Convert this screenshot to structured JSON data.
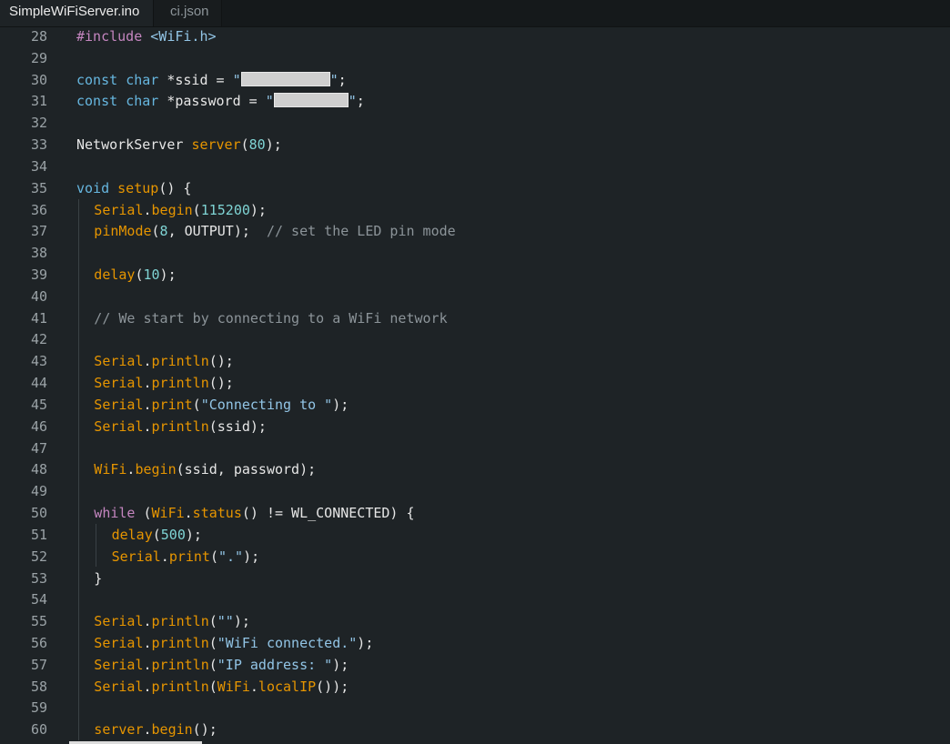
{
  "tabs": [
    {
      "label": "SimpleWiFiServer.ino",
      "active": true
    },
    {
      "label": "ci.json",
      "active": false
    }
  ],
  "colors": {
    "background": "#1e2326",
    "tabbar": "#15191b",
    "keyword": "#66b6df",
    "function": "#e69500",
    "number": "#7fd4d4",
    "string": "#92c5e6",
    "comment": "#8c9499",
    "preprocessor": "#c586c0"
  },
  "lines": [
    {
      "n": "28",
      "tokens": [
        {
          "t": "#include",
          "c": "inc"
        },
        {
          "t": " "
        },
        {
          "t": "<WiFi.h>",
          "c": "hdr"
        }
      ]
    },
    {
      "n": "29",
      "tokens": []
    },
    {
      "n": "30",
      "tokens": [
        {
          "t": "const",
          "c": "kw"
        },
        {
          "t": " "
        },
        {
          "t": "char",
          "c": "kw"
        },
        {
          "t": " *ssid = "
        },
        {
          "t": "\"",
          "c": "str"
        },
        {
          "redact": "long"
        },
        {
          "t": "\"",
          "c": "str"
        },
        {
          "t": ";"
        }
      ]
    },
    {
      "n": "31",
      "tokens": [
        {
          "t": "const",
          "c": "kw"
        },
        {
          "t": " "
        },
        {
          "t": "char",
          "c": "kw"
        },
        {
          "t": " *password = "
        },
        {
          "t": "\"",
          "c": "str"
        },
        {
          "redact": "short"
        },
        {
          "t": "\"",
          "c": "str"
        },
        {
          "t": ";"
        }
      ]
    },
    {
      "n": "32",
      "tokens": []
    },
    {
      "n": "33",
      "tokens": [
        {
          "t": "NetworkServer "
        },
        {
          "t": "server",
          "c": "fn"
        },
        {
          "t": "("
        },
        {
          "t": "80",
          "c": "num"
        },
        {
          "t": ");"
        }
      ]
    },
    {
      "n": "34",
      "tokens": []
    },
    {
      "n": "35",
      "tokens": [
        {
          "t": "void",
          "c": "kw"
        },
        {
          "t": " "
        },
        {
          "t": "setup",
          "c": "fn"
        },
        {
          "t": "() {"
        }
      ]
    },
    {
      "n": "36",
      "indent": 1,
      "tokens": [
        {
          "t": "Serial",
          "c": "fn"
        },
        {
          "t": "."
        },
        {
          "t": "begin",
          "c": "fn"
        },
        {
          "t": "("
        },
        {
          "t": "115200",
          "c": "num"
        },
        {
          "t": ");"
        }
      ]
    },
    {
      "n": "37",
      "indent": 1,
      "tokens": [
        {
          "t": "pinMode",
          "c": "fn"
        },
        {
          "t": "("
        },
        {
          "t": "8",
          "c": "num"
        },
        {
          "t": ", OUTPUT);  "
        },
        {
          "t": "// set the LED pin mode",
          "c": "com"
        }
      ]
    },
    {
      "n": "38",
      "tokens": []
    },
    {
      "n": "39",
      "indent": 1,
      "tokens": [
        {
          "t": "delay",
          "c": "fn"
        },
        {
          "t": "("
        },
        {
          "t": "10",
          "c": "num"
        },
        {
          "t": ");"
        }
      ]
    },
    {
      "n": "40",
      "tokens": []
    },
    {
      "n": "41",
      "indent": 1,
      "tokens": [
        {
          "t": "// We start by connecting to a WiFi network",
          "c": "com"
        }
      ]
    },
    {
      "n": "42",
      "tokens": []
    },
    {
      "n": "43",
      "indent": 1,
      "tokens": [
        {
          "t": "Serial",
          "c": "fn"
        },
        {
          "t": "."
        },
        {
          "t": "println",
          "c": "fn"
        },
        {
          "t": "();"
        }
      ]
    },
    {
      "n": "44",
      "indent": 1,
      "tokens": [
        {
          "t": "Serial",
          "c": "fn"
        },
        {
          "t": "."
        },
        {
          "t": "println",
          "c": "fn"
        },
        {
          "t": "();"
        }
      ]
    },
    {
      "n": "45",
      "indent": 1,
      "tokens": [
        {
          "t": "Serial",
          "c": "fn"
        },
        {
          "t": "."
        },
        {
          "t": "print",
          "c": "fn"
        },
        {
          "t": "("
        },
        {
          "t": "\"Connecting to \"",
          "c": "str"
        },
        {
          "t": ");"
        }
      ]
    },
    {
      "n": "46",
      "indent": 1,
      "tokens": [
        {
          "t": "Serial",
          "c": "fn"
        },
        {
          "t": "."
        },
        {
          "t": "println",
          "c": "fn"
        },
        {
          "t": "(ssid);"
        }
      ]
    },
    {
      "n": "47",
      "tokens": []
    },
    {
      "n": "48",
      "indent": 1,
      "tokens": [
        {
          "t": "WiFi",
          "c": "fn"
        },
        {
          "t": "."
        },
        {
          "t": "begin",
          "c": "fn"
        },
        {
          "t": "(ssid, password);"
        }
      ]
    },
    {
      "n": "49",
      "tokens": []
    },
    {
      "n": "50",
      "indent": 1,
      "tokens": [
        {
          "t": "while",
          "c": "kw2"
        },
        {
          "t": " ("
        },
        {
          "t": "WiFi",
          "c": "fn"
        },
        {
          "t": "."
        },
        {
          "t": "status",
          "c": "fn"
        },
        {
          "t": "() != WL_CONNECTED) {"
        }
      ]
    },
    {
      "n": "51",
      "indent": 2,
      "tokens": [
        {
          "t": "delay",
          "c": "fn"
        },
        {
          "t": "("
        },
        {
          "t": "500",
          "c": "num"
        },
        {
          "t": ");"
        }
      ]
    },
    {
      "n": "52",
      "indent": 2,
      "tokens": [
        {
          "t": "Serial",
          "c": "fn"
        },
        {
          "t": "."
        },
        {
          "t": "print",
          "c": "fn"
        },
        {
          "t": "("
        },
        {
          "t": "\".\"",
          "c": "str"
        },
        {
          "t": ");"
        }
      ]
    },
    {
      "n": "53",
      "indent": 1,
      "tokens": [
        {
          "t": "}"
        }
      ]
    },
    {
      "n": "54",
      "tokens": []
    },
    {
      "n": "55",
      "indent": 1,
      "tokens": [
        {
          "t": "Serial",
          "c": "fn"
        },
        {
          "t": "."
        },
        {
          "t": "println",
          "c": "fn"
        },
        {
          "t": "("
        },
        {
          "t": "\"\"",
          "c": "str"
        },
        {
          "t": ");"
        }
      ]
    },
    {
      "n": "56",
      "indent": 1,
      "tokens": [
        {
          "t": "Serial",
          "c": "fn"
        },
        {
          "t": "."
        },
        {
          "t": "println",
          "c": "fn"
        },
        {
          "t": "("
        },
        {
          "t": "\"WiFi connected.\"",
          "c": "str"
        },
        {
          "t": ");"
        }
      ]
    },
    {
      "n": "57",
      "indent": 1,
      "tokens": [
        {
          "t": "Serial",
          "c": "fn"
        },
        {
          "t": "."
        },
        {
          "t": "println",
          "c": "fn"
        },
        {
          "t": "("
        },
        {
          "t": "\"IP address: \"",
          "c": "str"
        },
        {
          "t": ");"
        }
      ]
    },
    {
      "n": "58",
      "indent": 1,
      "tokens": [
        {
          "t": "Serial",
          "c": "fn"
        },
        {
          "t": "."
        },
        {
          "t": "println",
          "c": "fn"
        },
        {
          "t": "("
        },
        {
          "t": "WiFi",
          "c": "fn"
        },
        {
          "t": "."
        },
        {
          "t": "localIP",
          "c": "fn"
        },
        {
          "t": "());"
        }
      ]
    },
    {
      "n": "59",
      "tokens": []
    },
    {
      "n": "60",
      "indent": 1,
      "tokens": [
        {
          "t": "server",
          "c": "fn"
        },
        {
          "t": "."
        },
        {
          "t": "begin",
          "c": "fn"
        },
        {
          "t": "();"
        }
      ]
    }
  ]
}
